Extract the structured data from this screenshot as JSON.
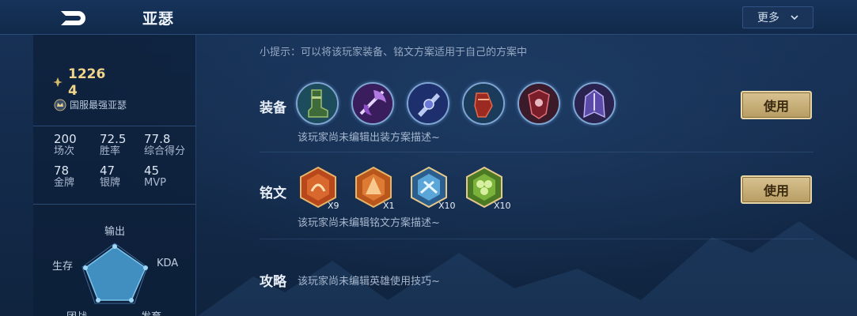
{
  "header": {
    "title": "亚瑟",
    "more_label": "更多"
  },
  "player": {
    "score": "1226 4",
    "rank_title": "国服最强亚瑟"
  },
  "stats": [
    {
      "value": "200",
      "label": "场次"
    },
    {
      "value": "72.5",
      "label": "胜率"
    },
    {
      "value": "77.8",
      "label": "综合得分"
    },
    {
      "value": "78",
      "label": "金牌"
    },
    {
      "value": "47",
      "label": "银牌"
    },
    {
      "value": "45",
      "label": "MVP"
    }
  ],
  "radar": {
    "labels": [
      "输出",
      "KDA",
      "发育",
      "团战",
      "生存"
    ]
  },
  "tip": "小提示：可以将该玩家装备、铭文方案适用于自己的方案中",
  "equipment": {
    "title": "装备",
    "description": "该玩家尚未编辑出装方案描述~",
    "use_label": "使用",
    "items": [
      {
        "icon": "boots-icon"
      },
      {
        "icon": "purple-axe-icon"
      },
      {
        "icon": "blue-blade-icon"
      },
      {
        "icon": "red-gauntlet-icon"
      },
      {
        "icon": "red-armor-icon"
      },
      {
        "icon": "purple-cloak-icon"
      }
    ]
  },
  "runes": {
    "title": "铭文",
    "description": "该玩家尚未编辑铭文方案描述~",
    "use_label": "使用",
    "items": [
      {
        "icon": "red-rune-icon",
        "count": "X9",
        "color": "#c2531f"
      },
      {
        "icon": "orange-rune-icon",
        "count": "X1",
        "color": "#c7662a"
      },
      {
        "icon": "blue-rune-icon",
        "count": "X10",
        "color": "#3d7fb8"
      },
      {
        "icon": "green-rune-icon",
        "count": "X10",
        "color": "#6a9a2e"
      }
    ]
  },
  "guide": {
    "title": "攻略",
    "description": "该玩家尚未编辑英雄使用技巧~"
  },
  "colors": {
    "accent_gold": "#f0d58a",
    "button_gold": "#c9b07a",
    "panel_bg": "#132a4a"
  }
}
